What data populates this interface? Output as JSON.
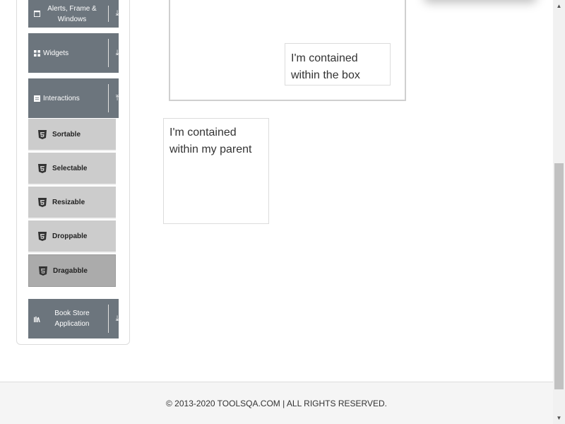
{
  "sidebar": {
    "groups": [
      {
        "label": "Alerts, Frame & Windows",
        "icon": "window-icon",
        "arrow": "⤓"
      },
      {
        "label": "Widgets",
        "icon": "grid-icon",
        "arrow": "⤓"
      },
      {
        "label": "Interactions",
        "icon": "list-icon",
        "arrow": "⤒"
      },
      {
        "label": "Book Store Application",
        "icon": "books-icon",
        "arrow": "⤓"
      }
    ],
    "items": [
      {
        "label": "Sortable",
        "icon": "html5-icon"
      },
      {
        "label": "Selectable",
        "icon": "html5-icon"
      },
      {
        "label": "Resizable",
        "icon": "html5-icon"
      },
      {
        "label": "Droppable",
        "icon": "html5-icon"
      },
      {
        "label": "Dragabble",
        "icon": "html5-icon",
        "active": true
      }
    ]
  },
  "draggables": {
    "box_contained": "I'm contained within the box",
    "parent_contained": "I'm contained within my parent"
  },
  "footer": {
    "text": "© 2013-2020 TOOLSQA.COM | ALL RIGHTS RESERVED."
  },
  "colors": {
    "group_bg": "#6c757d",
    "item_bg": "#cccccc",
    "item_active_bg": "#ababab"
  }
}
